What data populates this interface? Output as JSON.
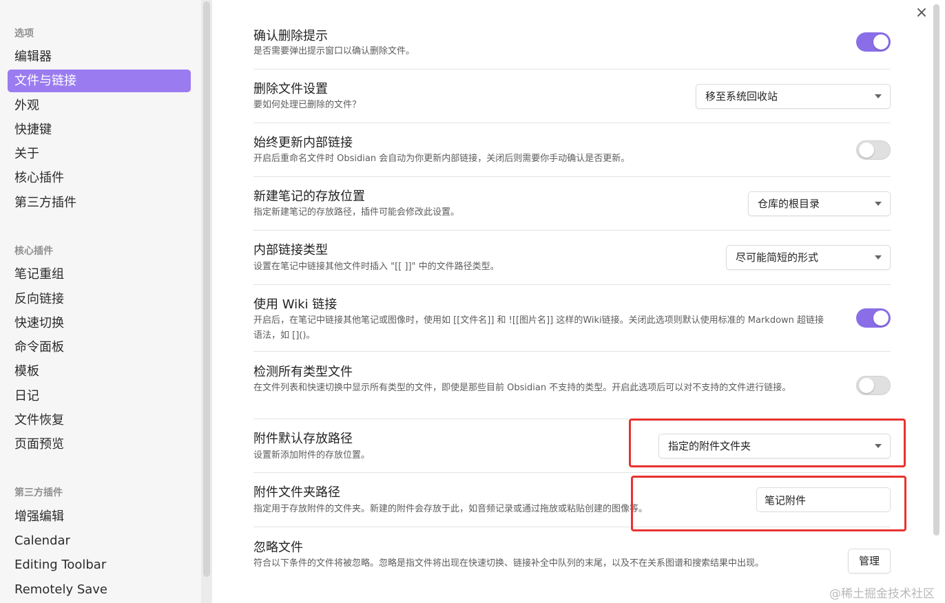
{
  "sidebar": {
    "sections": [
      {
        "title": "选项",
        "items": [
          "编辑器",
          "文件与链接",
          "外观",
          "快捷键",
          "关于",
          "核心插件",
          "第三方插件"
        ]
      },
      {
        "title": "核心插件",
        "items": [
          "笔记重组",
          "反向链接",
          "快速切换",
          "命令面板",
          "模板",
          "日记",
          "文件恢复",
          "页面预览"
        ]
      },
      {
        "title": "第三方插件",
        "items": [
          "增强编辑",
          "Calendar",
          "Editing Toolbar",
          "Remotely Save"
        ]
      }
    ],
    "active_item": "文件与链接"
  },
  "close_icon": "×",
  "settings": [
    {
      "name": "确认删除提示",
      "desc": "是否需要弹出提示窗口以确认删除文件。",
      "control": "toggle",
      "on": true
    },
    {
      "name": "删除文件设置",
      "desc": "要如何处理已删除的文件？",
      "control": "dropdown",
      "value": "移至系统回收站"
    },
    {
      "name": "始终更新内部链接",
      "desc": "开启后重命名文件时 Obsidian 会自动为你更新内部链接，关闭后则需要你手动确认是否更新。",
      "control": "toggle",
      "on": false
    },
    {
      "name": "新建笔记的存放位置",
      "desc": "指定新建笔记的存放路径，插件可能会修改此设置。",
      "control": "dropdown",
      "value": "仓库的根目录"
    },
    {
      "name": "内部链接类型",
      "desc": "设置在笔记中链接其他文件时插入 \"[[ ]]\" 中的文件路径类型。",
      "control": "dropdown",
      "value": "尽可能简短的形式"
    },
    {
      "name": "使用 Wiki 链接",
      "desc": "开启后，在笔记中链接其他笔记或图像时，使用如 [[文件名]] 和 ![[图片名]] 这样的Wiki链接。关闭此选项则默认使用标准的 Markdown 超链接语法，如 []()。",
      "control": "toggle",
      "on": true
    },
    {
      "name": "检测所有类型文件",
      "desc": "在文件列表和快速切换中显示所有类型的文件，即使是那些目前 Obsidian 不支持的类型。开启此选项后可以对不支持的文件进行链接。",
      "control": "toggle",
      "on": false
    },
    {
      "name": "附件默认存放路径",
      "desc": "设置新添加附件的存放位置。",
      "control": "dropdown",
      "value": "指定的附件文件夹"
    },
    {
      "name": "附件文件夹路径",
      "desc": "指定用于存放附件的文件夹。新建的附件会存放于此，如音频记录或通过拖放或粘贴创建的图像等。",
      "control": "text",
      "value": "笔记附件"
    },
    {
      "name": "忽略文件",
      "desc": "符合以下条件的文件将被忽略。忽略是指文件将出现在快速切换、链接补全中队列的末尾，以及不在关系图谱和搜索结果中出现。",
      "control": "button",
      "label": "管理"
    }
  ],
  "watermark": "@稀土掘金技术社区",
  "colors": {
    "accent": "#8a6ee8",
    "active_item": "#9b7cf0",
    "highlight": "#e8322f"
  }
}
